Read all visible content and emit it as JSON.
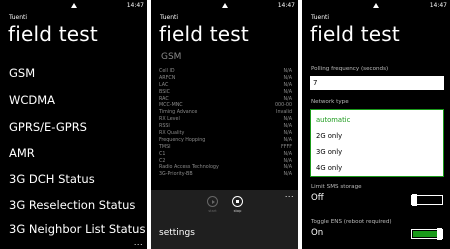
{
  "status": {
    "time": "14:47"
  },
  "screen1": {
    "app_name": "Tuenti",
    "title": "field test",
    "items": [
      "GSM",
      "WCDMA",
      "GPRS/E-GPRS",
      "AMR",
      "3G DCH Status",
      "3G Reselection Status",
      "3G Neighbor List Status"
    ],
    "more": "..."
  },
  "screen2": {
    "app_name": "Tuenti",
    "title": "field test",
    "subtitle": "GSM",
    "rows": [
      {
        "k": "Cell ID",
        "v": "N/A"
      },
      {
        "k": "ARFCN",
        "v": "N/A"
      },
      {
        "k": "LAC",
        "v": "N/A"
      },
      {
        "k": "BSIC",
        "v": "N/A"
      },
      {
        "k": "RAC",
        "v": "N/A"
      },
      {
        "k": "MCC-MNC",
        "v": "000-00"
      },
      {
        "k": "Timing Advance",
        "v": "Invalid"
      },
      {
        "k": "RX Level",
        "v": "N/A"
      },
      {
        "k": "RSSI",
        "v": "N/A"
      },
      {
        "k": "RX Quality",
        "v": "N/A"
      },
      {
        "k": "Frequency Hopping",
        "v": "N/A"
      },
      {
        "k": "TMSI",
        "v": "FFFF"
      },
      {
        "k": "C1",
        "v": "N/A"
      },
      {
        "k": "C2",
        "v": "N/A"
      },
      {
        "k": "Radio Access Technology",
        "v": "N/A"
      },
      {
        "k": "3G-Priority-BB",
        "v": "N/A"
      }
    ],
    "appbar": {
      "start_label": "start",
      "stop_label": "stop",
      "more": "...",
      "menu_item": "settings"
    }
  },
  "screen3": {
    "app_name": "Tuenti",
    "title": "field test",
    "polling_label": "Polling frequency (seconds)",
    "polling_value": "7",
    "network_label": "Network type",
    "network_options": [
      "automatic",
      "2G only",
      "3G only",
      "4G only"
    ],
    "network_selected": "automatic",
    "limit_sms_label": "Limit SMS storage",
    "limit_sms_state": "Off",
    "ens_label": "Toggle ENS (reboot required)",
    "ens_state": "On",
    "accent_color": "#1a9a1a"
  }
}
